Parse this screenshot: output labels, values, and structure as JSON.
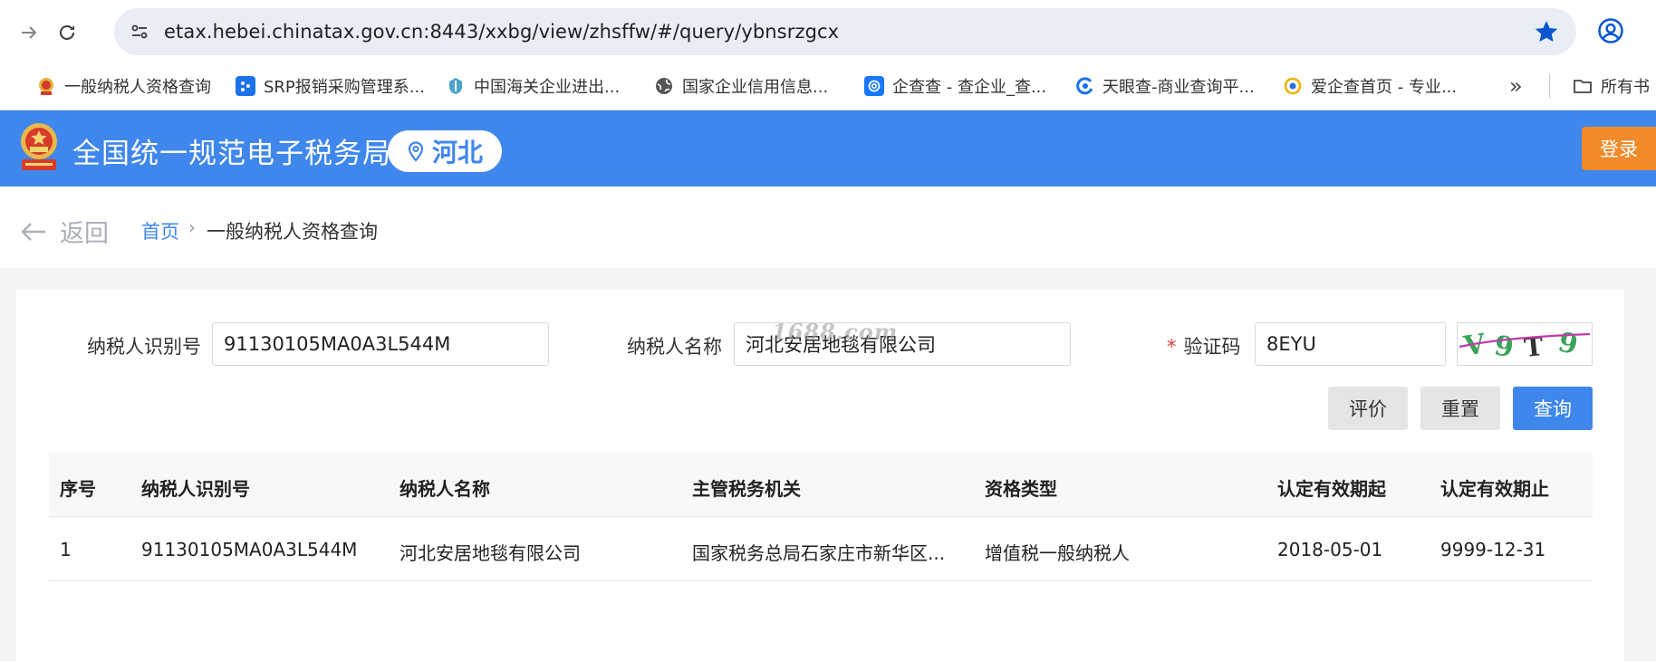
{
  "browser": {
    "url": "etax.hebei.chinatax.gov.cn:8443/xxbg/view/zhsffw/#/query/ybnsrzgcx",
    "bookmarks": [
      {
        "label": "一般纳税人资格查询",
        "icon": "emblem-icon"
      },
      {
        "label": "SRP报销采购管理系...",
        "icon": "srp-icon"
      },
      {
        "label": "中国海关企业进出...",
        "icon": "customs-icon"
      },
      {
        "label": "国家企业信用信息...",
        "icon": "globe-icon"
      },
      {
        "label": "企查查 - 查企业_查...",
        "icon": "qcc-icon"
      },
      {
        "label": "天眼查-商业查询平...",
        "icon": "tianyancha-icon"
      },
      {
        "label": "爱企查首页 - 专业...",
        "icon": "aiqicha-icon"
      }
    ],
    "overflow_label": "»",
    "all_bookmarks_label": "所有书"
  },
  "header": {
    "title": "全国统一规范电子税务局",
    "region": "河北",
    "login_label": "登录",
    "brand_color": "#3f87ec",
    "login_color": "#f08a2a"
  },
  "breadcrumb": {
    "back_label": "返回",
    "home": "首页",
    "separator": "›",
    "current": "一般纳税人资格查询"
  },
  "form": {
    "taxpayer_id_label": "纳税人识别号",
    "taxpayer_id_value": "91130105MA0A3L544M",
    "taxpayer_name_label": "纳税人名称",
    "taxpayer_name_value": "河北安居地毯有限公司",
    "required_mark": "*",
    "captcha_label": "验证码",
    "captcha_value": "8EYU",
    "captcha_image_text": "V9T9"
  },
  "actions": {
    "evaluate": "评价",
    "reset": "重置",
    "query": "查询"
  },
  "table": {
    "headers": [
      "序号",
      "纳税人识别号",
      "纳税人名称",
      "主管税务机关",
      "资格类型",
      "认定有效期起",
      "认定有效期止"
    ],
    "rows": [
      [
        "1",
        "91130105MA0A3L544M",
        "河北安居地毯有限公司",
        "国家税务总局石家庄市新华区...",
        "增值税一般纳税人",
        "2018-05-01",
        "9999-12-31"
      ]
    ]
  },
  "watermark": "1688.com"
}
